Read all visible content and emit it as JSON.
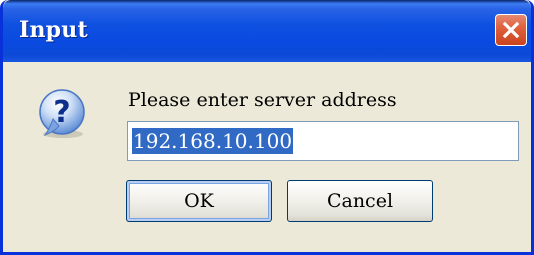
{
  "window": {
    "title": "Input"
  },
  "dialog": {
    "prompt": "Please enter server address",
    "input_value": "192.168.10.100",
    "ok_label": "OK",
    "cancel_label": "Cancel",
    "icon": "question-icon"
  },
  "colors": {
    "titlebar": "#0a4ae0",
    "close_button": "#e0623f",
    "dialog_background": "#ece9d8",
    "selection": "#316ac5"
  }
}
